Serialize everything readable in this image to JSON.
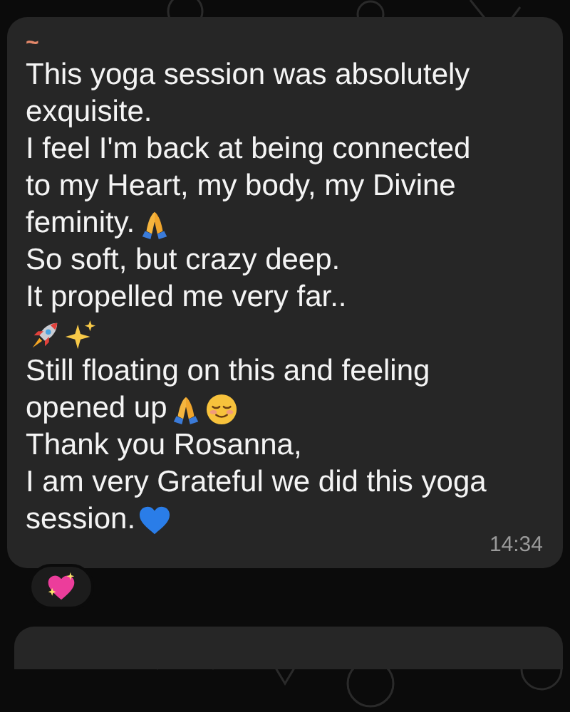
{
  "message": {
    "sender": "~",
    "lines": [
      {
        "parts": [
          {
            "kind": "text",
            "text": "This yoga session was absolutely"
          }
        ]
      },
      {
        "parts": [
          {
            "kind": "text",
            "text": "exquisite."
          }
        ]
      },
      {
        "parts": [
          {
            "kind": "text",
            "text": "I feel I'm back at being connected"
          }
        ]
      },
      {
        "parts": [
          {
            "kind": "text",
            "text": "to my Heart, my body, my Divine"
          }
        ]
      },
      {
        "parts": [
          {
            "kind": "text",
            "text": "feminity."
          },
          {
            "kind": "pray"
          }
        ]
      },
      {
        "parts": [
          {
            "kind": "text",
            "text": "So soft, but crazy deep."
          }
        ]
      },
      {
        "parts": [
          {
            "kind": "text",
            "text": "It propelled me very far.."
          }
        ]
      },
      {
        "parts": [
          {
            "kind": "rocket"
          },
          {
            "kind": "sparkles"
          }
        ]
      },
      {
        "parts": [
          {
            "kind": "text",
            "text": "Still floating on this and feeling"
          }
        ]
      },
      {
        "parts": [
          {
            "kind": "text",
            "text": "opened up"
          },
          {
            "kind": "pray"
          },
          {
            "kind": "relieved"
          }
        ]
      },
      {
        "parts": [
          {
            "kind": "text",
            "text": "Thank you Rosanna,"
          }
        ]
      },
      {
        "parts": [
          {
            "kind": "text",
            "text": "I am very Grateful we did this yoga"
          }
        ]
      },
      {
        "parts": [
          {
            "kind": "text",
            "text": "session."
          },
          {
            "kind": "blueheart"
          }
        ]
      }
    ],
    "time": "14:34"
  },
  "reaction": {
    "kind": "sparklingheart"
  }
}
